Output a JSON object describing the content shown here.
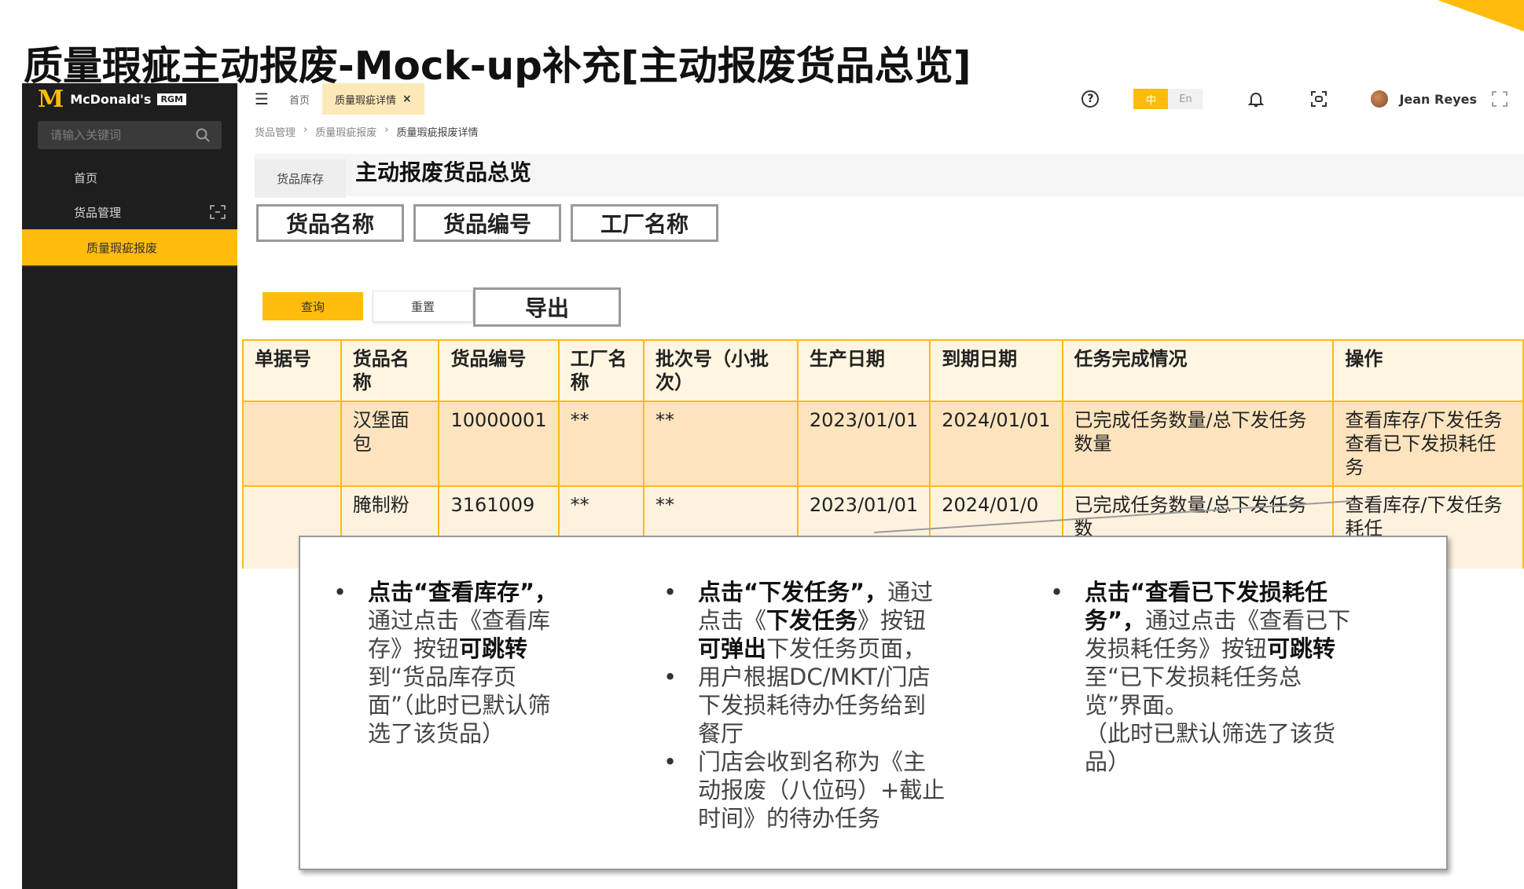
{
  "slide_title": "质量瑕疵主动报废-Mock-up补充[主动报废货品总览]",
  "brand": {
    "name": "McDonald's",
    "badge": "RGM",
    "accent": "#FFBC0D"
  },
  "sidebar": {
    "search_placeholder": "请输入关键词",
    "items": [
      {
        "label": "首页"
      },
      {
        "label": "货品管理"
      }
    ],
    "sub_item": "质量瑕疵报废"
  },
  "topbar": {
    "tabs": [
      {
        "label": "首页"
      },
      {
        "label": "质量瑕疵详情"
      }
    ],
    "lang_on": "中",
    "lang_off": "En",
    "user": "Jean Reyes"
  },
  "breadcrumb": [
    "货品管理",
    "质量瑕疵报废",
    "质量瑕疵报废详情"
  ],
  "page": {
    "tab": "货品库存",
    "heading": "主动报废货品总览"
  },
  "filters": [
    "货品名称",
    "货品编号",
    "工厂名称"
  ],
  "buttons": {
    "query": "查询",
    "reset": "重置",
    "export": "导出"
  },
  "table": {
    "headers": [
      "单据号",
      "货品名称",
      "货品编号",
      "工厂名称",
      "批次号（小批次）",
      "生产日期",
      "到期日期",
      "任务完成情况",
      "操作"
    ],
    "rows": [
      [
        "",
        "汉堡面包",
        "10000001",
        "**",
        "**",
        "2023/01/01",
        "2024/01/01",
        "已完成任务数量/总下发任务数量",
        "查看库存/下发任务查看已下发损耗任务"
      ],
      [
        "",
        "腌制粉",
        "3161009",
        "**",
        "**",
        "2023/01/01",
        "2024/01/0",
        "已完成任务数量/总下发任务数",
        "查看库存/下发任务耗任"
      ]
    ]
  },
  "callout": {
    "col1": {
      "bold": "点击“查看库存”，",
      "t1": "通过点击《查看库存》按钮",
      "b2": "可跳转",
      "t2": "到“货品库存页面”（此时已默认筛选了该货品）"
    },
    "col2": {
      "b1": "点击“下发任务”，",
      "t1": "通过点击《",
      "b2": "下发任务",
      "t2": "》按钮",
      "b3": "可弹出",
      "t3": "下发任务页面，",
      "li2": "用户根据DC/MKT/门店下发损耗待办任务给到餐厅",
      "li3": "门店会收到名称为《主动报废（八位码）+截止时间》的待办任务"
    },
    "col3": {
      "bold": "点击“查看已下发损耗任务”，",
      "t1": "通过点击《查看已下发损耗任务》按钮",
      "b2": "可跳转",
      "t2": "至“已下发损耗任务总览”界面。",
      "t3": "（此时已默认筛选了该货品）"
    }
  }
}
